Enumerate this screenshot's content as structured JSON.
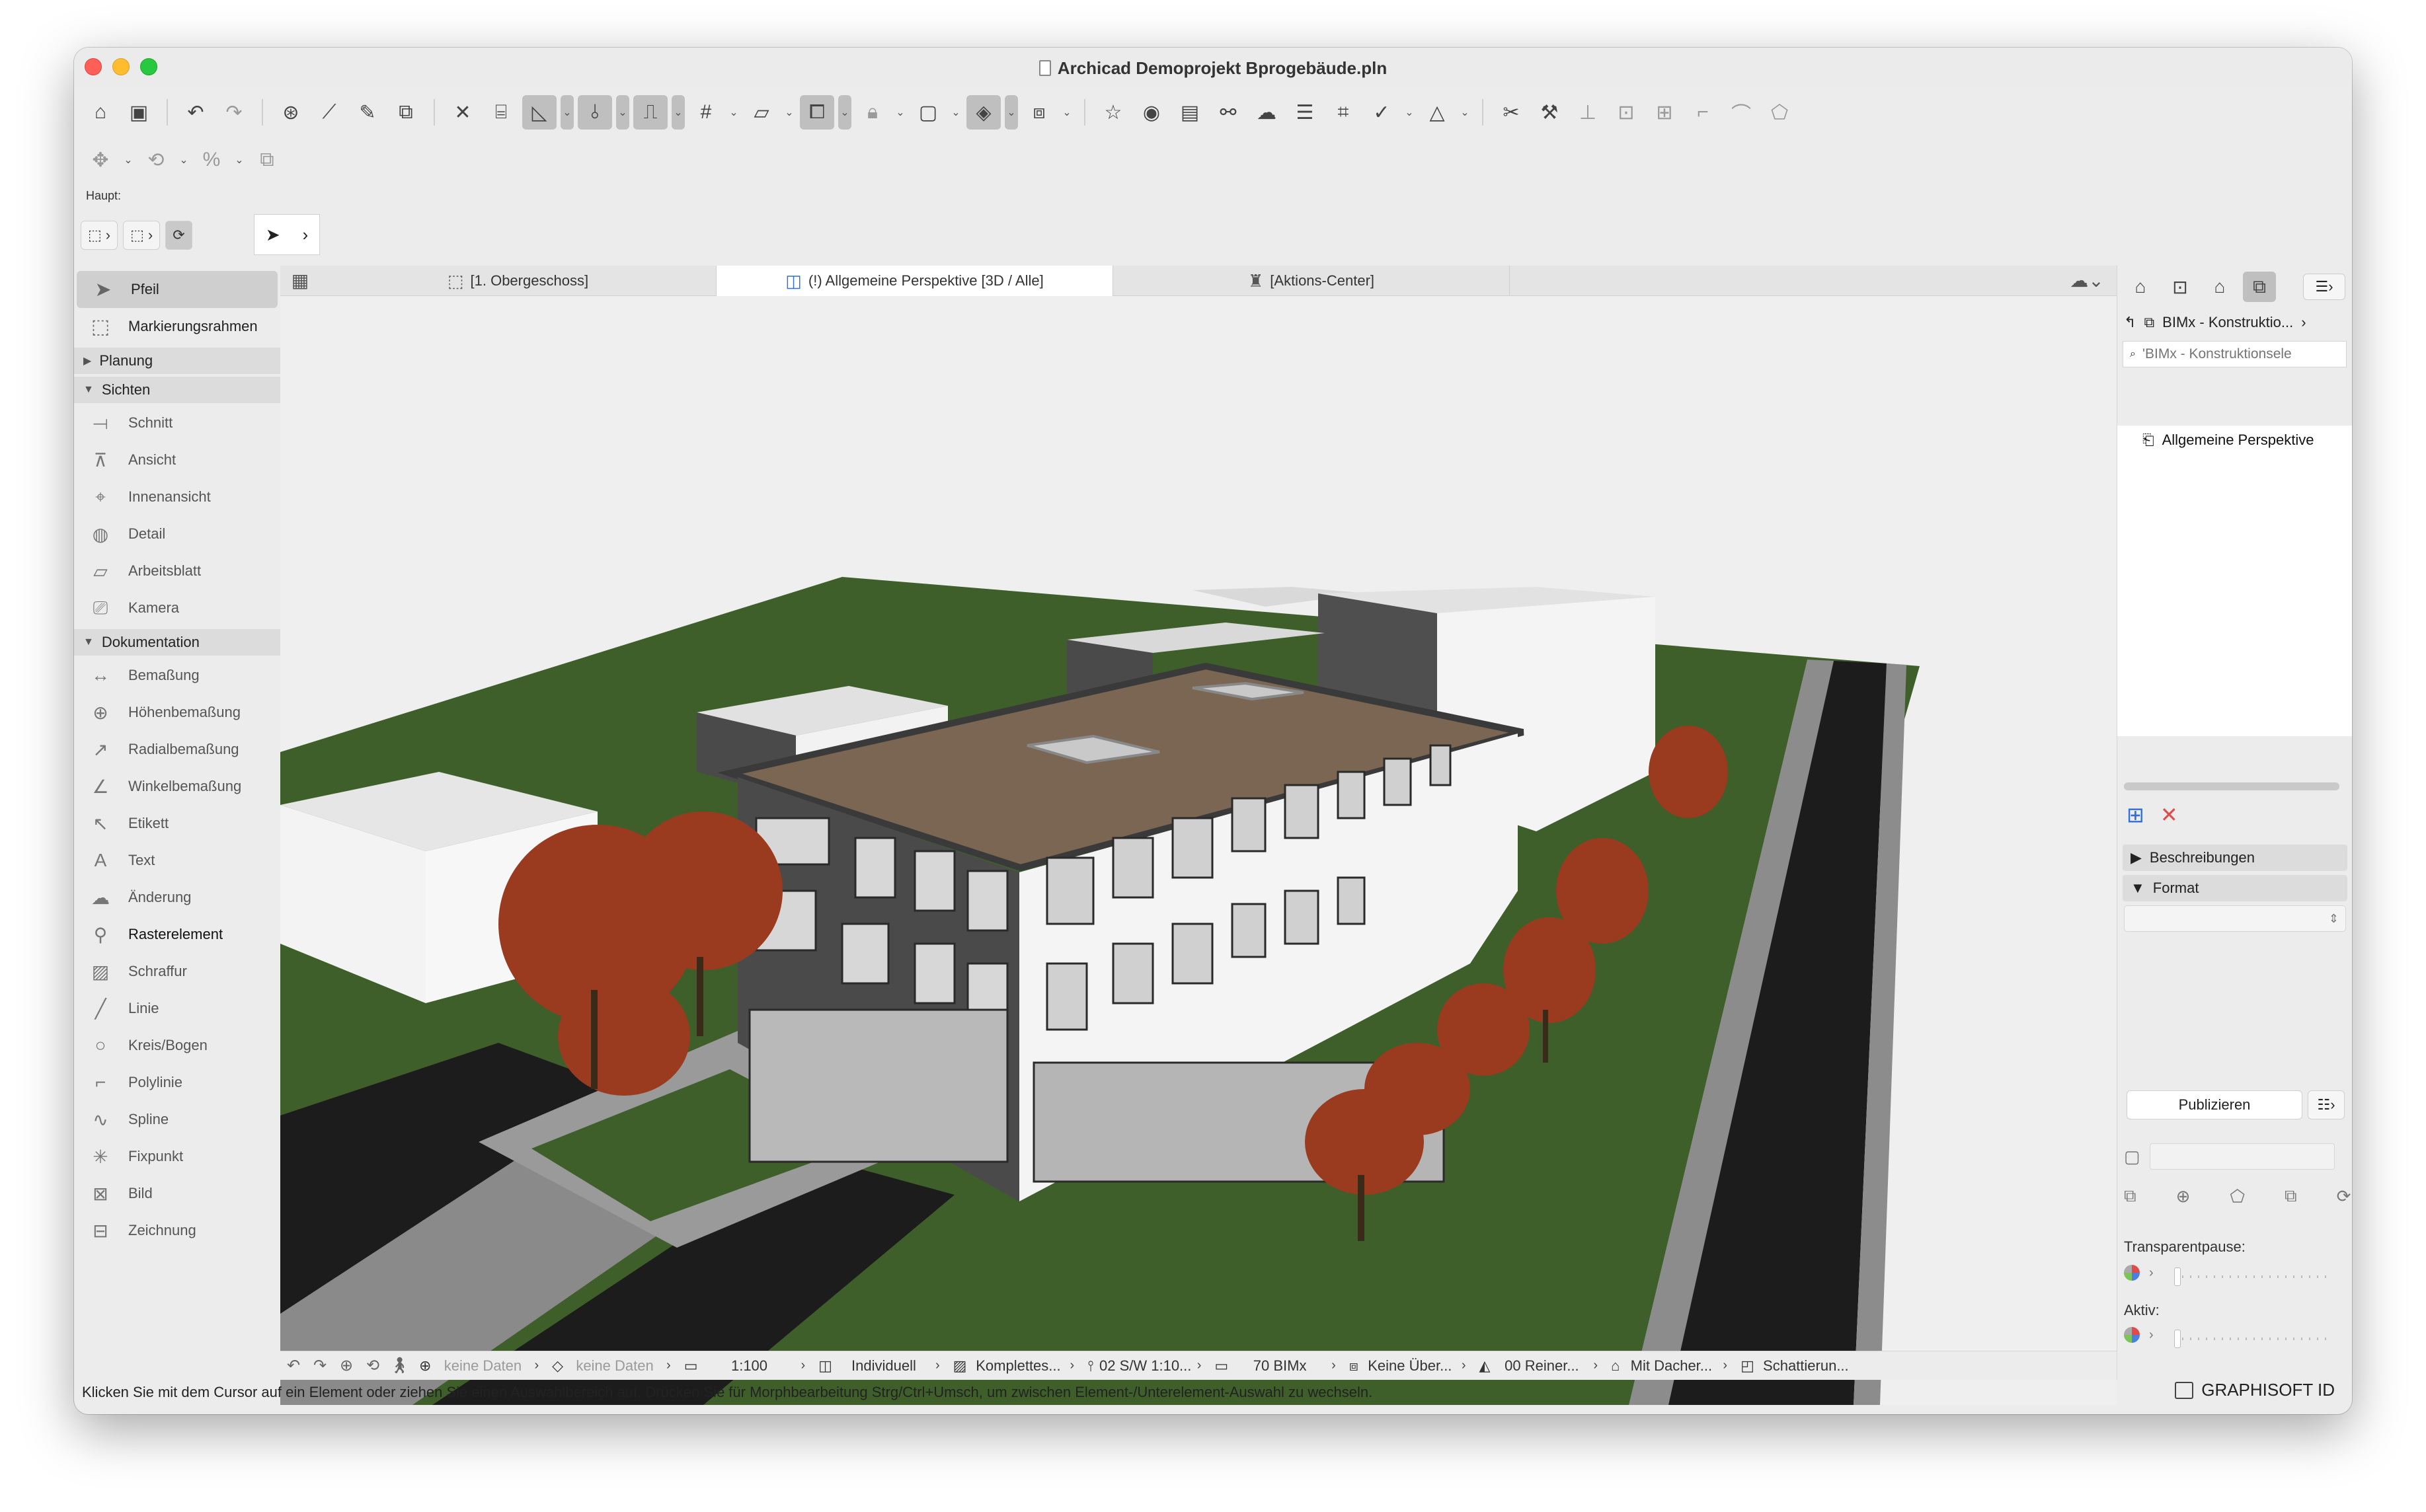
{
  "window": {
    "title": "Archicad Demoprojekt Bprogebäude.pln"
  },
  "infobox": {
    "label": "Haupt:"
  },
  "palette": {
    "items_top": [
      {
        "label": "Pfeil",
        "icon": "arrow-pointer-icon"
      },
      {
        "label": "Markierungsrahmen",
        "icon": "marquee-icon"
      }
    ],
    "groups": {
      "planung": "Planung",
      "sichten": "Sichten",
      "dokumentation": "Dokumentation"
    },
    "sichten_items": [
      "Schnitt",
      "Ansicht",
      "Innenansicht",
      "Detail",
      "Arbeitsblatt",
      "Kamera"
    ],
    "doku_items": [
      "Bemaßung",
      "Höhenbemaßung",
      "Radialbemaßung",
      "Winkelbemaßung",
      "Etikett",
      "Text",
      "Änderung",
      "Rasterelement",
      "Schraffur",
      "Linie",
      "Kreis/Bogen",
      "Polylinie",
      "Spline",
      "Fixpunkt",
      "Bild",
      "Zeichnung"
    ]
  },
  "tabs": [
    {
      "label": "[1. Obergeschoss]"
    },
    {
      "label": "(!) Allgemeine Perspektive [3D / Alle]"
    },
    {
      "label": "[Aktions-Center]"
    }
  ],
  "statusbar": {
    "undo_data": "keine Daten",
    "redo_data": "keine Daten",
    "scale": "1:100",
    "layer_combo": "Individuell",
    "model_view": "Komplettes...",
    "pen_set": "02 S/W 1:10...",
    "override": "70 BIMx",
    "renovation": "Keine Über...",
    "structure": "00 Reiner...",
    "roof": "Mit Dacher...",
    "shading": "Schattierun..."
  },
  "hint": "Klicken Sie mit dem Cursor auf ein Element oder ziehen Sie einen Auswahlbereich auf. Drücken Sie für Morphbearbeitung Strg/Ctrl+Umsch, um zwischen Element-/Unterelement-Auswahl zu wechseln.",
  "brand": "GRAPHISOFT ID",
  "navigator": {
    "set_name": "BIMx - Konstruktio...",
    "search_placeholder": "'BIMx - Konstruktionsele",
    "list_item": "Allgemeine Perspektive",
    "sections": {
      "descriptions": "Beschreibungen",
      "format": "Format"
    },
    "publish_label": "Publizieren",
    "transparent_label": "Transparentpause:",
    "active_label": "Aktiv:"
  },
  "colors": {
    "grass": "#3e5f2a",
    "road": "#1e1e1e",
    "wall_white": "#f4f4f4",
    "wall_dark": "#4a4a4a",
    "roof": "#7a6652",
    "tree": "#9a3a1e"
  }
}
